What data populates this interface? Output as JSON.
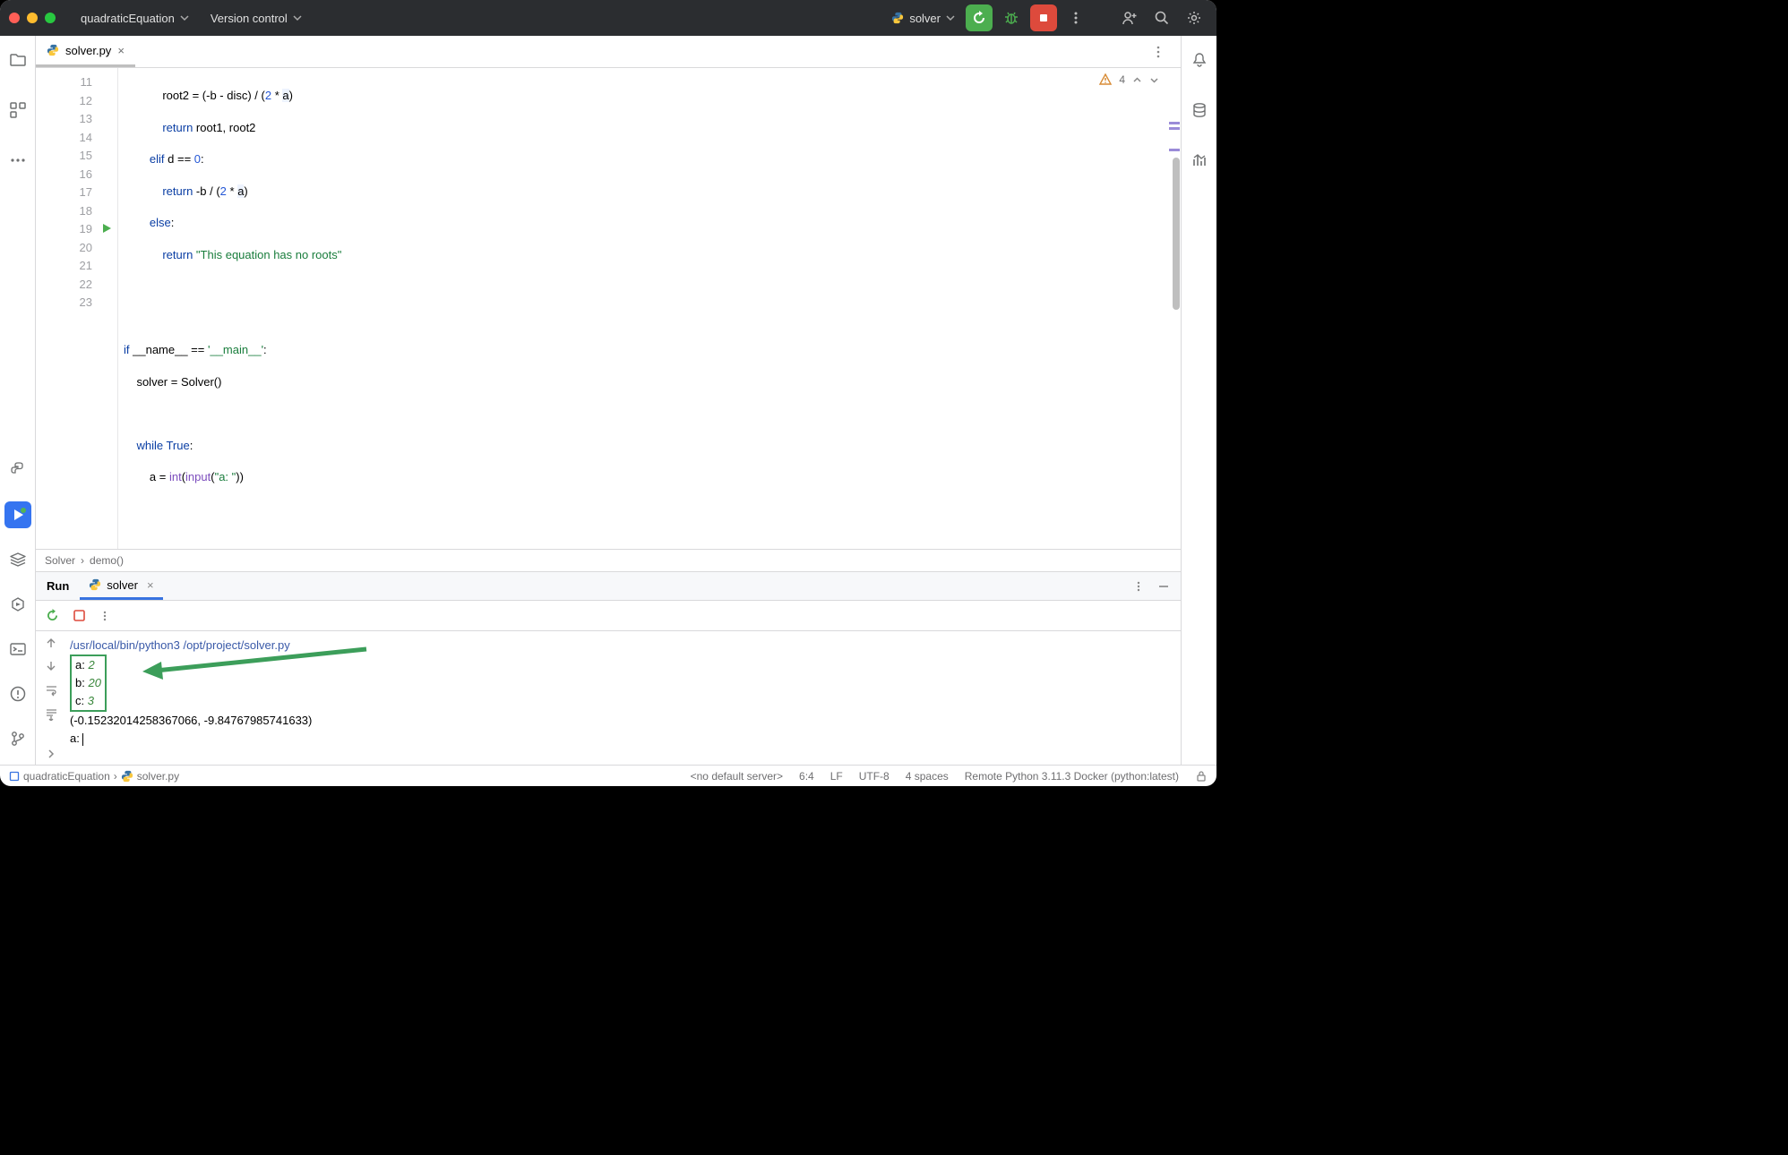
{
  "titlebar": {
    "project": "quadraticEquation",
    "vcs": "Version control",
    "run_config": "solver"
  },
  "tab": {
    "filename": "solver.py"
  },
  "inspector": {
    "warn_count": "4"
  },
  "gutter": [
    "11",
    "12",
    "13",
    "14",
    "15",
    "16",
    "17",
    "18",
    "19",
    "20",
    "21",
    "22",
    "23"
  ],
  "code": {
    "l11": {
      "a": "            root2 = (-b - disc) / (",
      "n1": "2",
      "star": " * ",
      "id": "a",
      "b": ")"
    },
    "l12": {
      "a": "            ",
      "kw": "return ",
      "b": "root1, root2"
    },
    "l13": {
      "a": "        ",
      "kw": "elif ",
      "b": "d == ",
      "n": "0",
      "c": ":"
    },
    "l14": {
      "a": "            ",
      "kw": "return ",
      "b": "-b / (",
      "n": "2",
      "star": " * ",
      "id": "a",
      "c": ")"
    },
    "l15": {
      "a": "        ",
      "kw": "else",
      "b": ":"
    },
    "l16": {
      "a": "            ",
      "kw": "return ",
      "s": "\"This equation has no roots\""
    },
    "l19": {
      "kw": "if ",
      "a": "__name__ == ",
      "s": "'__main__'",
      "b": ":"
    },
    "l20": {
      "a": "    solver = Solver()"
    },
    "l22": {
      "a": "    ",
      "kw": "while ",
      "b1": "True",
      "c": ":"
    },
    "l23": {
      "a": "        a = ",
      "fn": "int",
      "b": "(",
      "fn2": "input",
      "c": "(",
      "s": "\"a: \"",
      "d": "))"
    }
  },
  "breadcrumb": {
    "a": "Solver",
    "b": "demo()"
  },
  "run": {
    "title": "Run",
    "tab": "solver",
    "cmd": "/usr/local/bin/python3 /opt/project/solver.py",
    "in_a_lbl": "a: ",
    "in_a": "2",
    "in_b_lbl": "b: ",
    "in_b": "20",
    "in_c_lbl": "c: ",
    "in_c": "3",
    "result": "(-0.15232014258367066, -9.84767985741633)",
    "prompt": "a: "
  },
  "status": {
    "project": "quadraticEquation",
    "file": "solver.py",
    "server": "<no default server>",
    "pos": "6:4",
    "le": "LF",
    "enc": "UTF-8",
    "indent": "4 spaces",
    "interp": "Remote Python 3.11.3 Docker (python:latest)"
  }
}
